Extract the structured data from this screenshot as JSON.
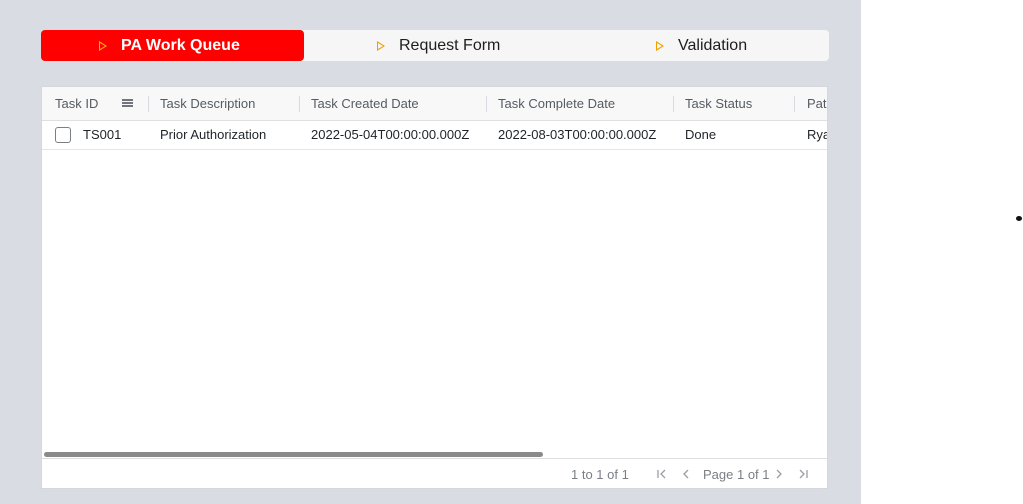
{
  "steps": [
    {
      "label": "PA Work Queue",
      "active": true
    },
    {
      "label": "Request Form",
      "active": false
    },
    {
      "label": "Validation",
      "active": false
    }
  ],
  "grid": {
    "columns": [
      "Task ID",
      "Task Description",
      "Task Created Date",
      "Task Complete Date",
      "Task Status",
      "Pati"
    ],
    "rows": [
      {
        "task_id": "TS001",
        "task_description": "Prior Authorization",
        "task_created_date": "2022-05-04T00:00:00.000Z",
        "task_complete_date": "2022-08-03T00:00:00.000Z",
        "task_status": "Done",
        "patient": "Ryar"
      }
    ]
  },
  "paging": {
    "summary": "1 to 1 of 1",
    "page": "Page 1 of 1"
  },
  "icons": {
    "step_marker": "play-triangle-icon",
    "column_menu": "menu-icon",
    "first": "first-page-icon",
    "prev": "prev-page-icon",
    "next": "next-page-icon",
    "last": "last-page-icon"
  },
  "colors": {
    "active_step_bg": "#ff0000",
    "step_marker": "#f0a000",
    "app_bg": "#d9dde3"
  }
}
